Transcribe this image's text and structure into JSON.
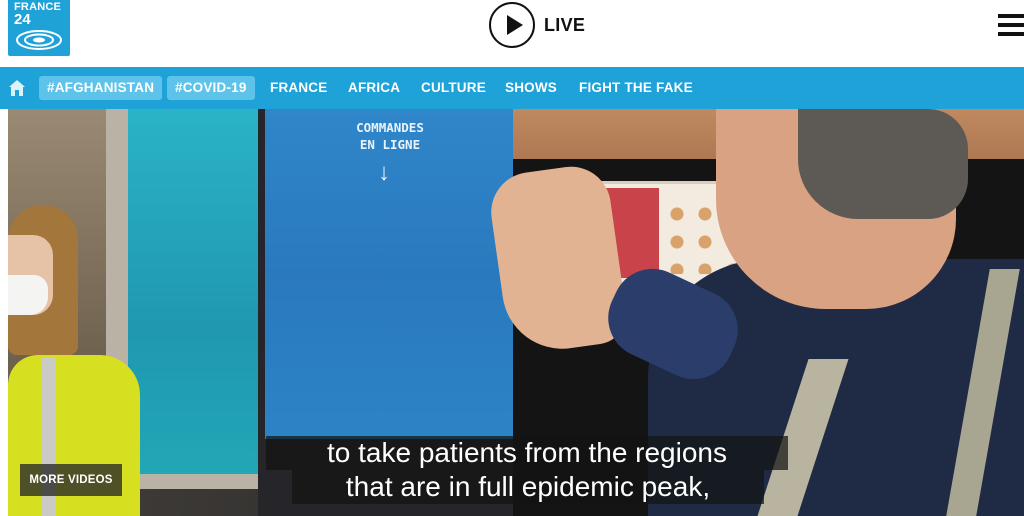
{
  "header": {
    "logo": {
      "line1": "FRANCE",
      "line2": "24"
    },
    "live_label": "LIVE",
    "icons": {
      "play": "play-icon",
      "menu": "hamburger-menu-icon"
    }
  },
  "nav": {
    "home_icon": "home-icon",
    "items": [
      {
        "label": "#AFGHANISTAN",
        "highlighted": true
      },
      {
        "label": "#COVID-19",
        "highlighted": true
      },
      {
        "label": "FRANCE",
        "highlighted": false
      },
      {
        "label": "AFRICA",
        "highlighted": false
      },
      {
        "label": "CULTURE",
        "highlighted": false
      },
      {
        "label": "SHOWS",
        "highlighted": false
      },
      {
        "label": "FIGHT THE FAKE",
        "highlighted": false
      }
    ]
  },
  "video": {
    "scene_text": {
      "line1": "COMMANDES",
      "line2": "EN LIGNE",
      "arrow": "↓"
    },
    "subtitles": [
      "to take patients from the regions",
      "that are in full epidemic peak,"
    ],
    "more_videos_label": "MORE VIDEOS"
  },
  "colors": {
    "brand": "#1ea2d8",
    "nav_pill": "#5ec3ea"
  }
}
